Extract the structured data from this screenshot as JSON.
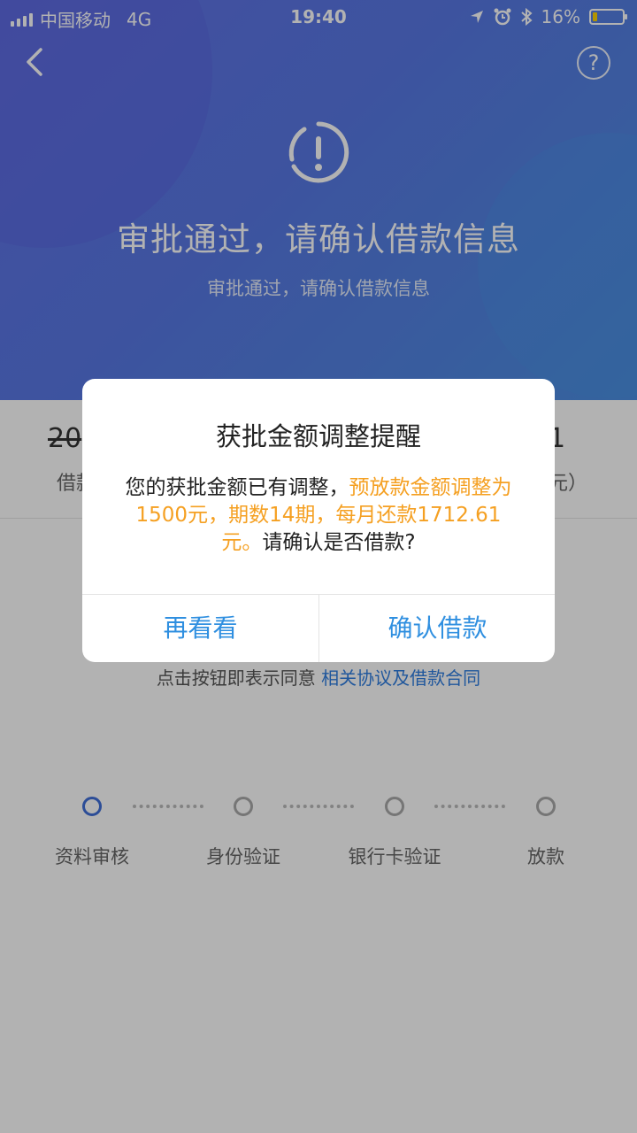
{
  "status_bar": {
    "carrier": "中国移动",
    "network": "4G",
    "time": "19:40",
    "battery_pct": "16%",
    "battery_fill_fraction": 0.16,
    "battery_color": "#ffd400"
  },
  "header": {
    "back_icon": "chevron-left-icon",
    "help_label": "?",
    "status_icon": "exclamation-circle-icon",
    "title": "审批通过，请确认借款信息",
    "subtitle": "审批通过，请确认借款信息"
  },
  "summary": {
    "left_value": "20",
    "left_label": "借款",
    "right_value": "1",
    "right_label": "元）"
  },
  "agreement": {
    "prefix": "点击按钮即表示同意",
    "link": "相关协议及借款合同"
  },
  "steps": [
    {
      "label": "资料审核",
      "active": true
    },
    {
      "label": "身份验证",
      "active": false
    },
    {
      "label": "银行卡验证",
      "active": false
    },
    {
      "label": "放款",
      "active": false
    }
  ],
  "dialog": {
    "title": "获批金额调整提醒",
    "body_prefix": "您的获批金额已有调整，",
    "body_highlight": "预放款金额调整为1500元，期数14期，每月还款1712.61元。",
    "body_suffix": "请确认是否借款?",
    "cancel_label": "再看看",
    "confirm_label": "确认借款"
  },
  "colors": {
    "accent": "#2f8fe0",
    "highlight": "#f5a022",
    "hero_start": "#6272e6",
    "hero_end": "#4c8fe2"
  }
}
